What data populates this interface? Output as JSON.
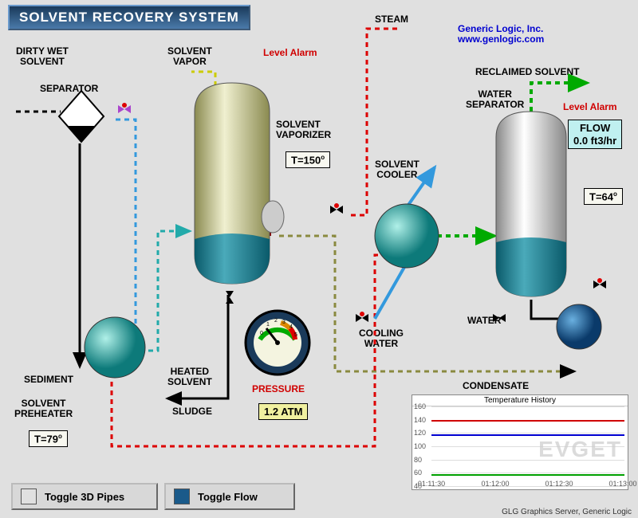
{
  "title": "SOLVENT RECOVERY SYSTEM",
  "company": {
    "name": "Generic Logic, Inc.",
    "url": "www.genlogic.com"
  },
  "labels": {
    "dirty_wet_solvent": "DIRTY WET\nSOLVENT",
    "separator": "SEPARATOR",
    "solvent_vapor": "SOLVENT\nVAPOR",
    "steam": "STEAM",
    "level_alarm": "Level Alarm",
    "solvent_vaporizer": "SOLVENT\nVAPORIZER",
    "reclaimed_solvent": "RECLAIMED SOLVENT",
    "water_separator": "WATER\nSEPARATOR",
    "solvent_cooler": "SOLVENT\nCOOLER",
    "sediment": "SEDIMENT",
    "heated_solvent": "HEATED\nSOLVENT",
    "solvent_preheater": "SOLVENT\nPREHEATER",
    "sludge": "SLUDGE",
    "pressure": "PRESSURE",
    "cooling_water": "COOLING\nWATER",
    "water": "WATER",
    "condensate": "CONDENSATE"
  },
  "values": {
    "vaporizer_temp": "T=150",
    "separator_temp": "T=64",
    "preheater_temp": "T=79",
    "pressure_atm": "1.2 ATM",
    "flow_label": "FLOW",
    "flow_value": "0.0 ft3/hr",
    "gauge_max": "5"
  },
  "buttons": {
    "toggle_3d": "Toggle 3D Pipes",
    "toggle_flow": "Toggle Flow"
  },
  "footer": "GLG Graphics Server, Generic Logic",
  "watermark": "EVGET",
  "chart_data": {
    "type": "line",
    "title": "Temperature History",
    "ylim": [
      40,
      160
    ],
    "yticks": [
      40,
      60,
      80,
      100,
      120,
      140,
      160
    ],
    "xticks": [
      "01:11:30",
      "01:12:00",
      "01:12:30",
      "01:13:00"
    ],
    "series": [
      {
        "name": "red",
        "color": "#d00000",
        "value": 140
      },
      {
        "name": "blue",
        "color": "#0000d0",
        "value": 118
      },
      {
        "name": "green",
        "color": "#00a000",
        "value": 58
      }
    ]
  }
}
